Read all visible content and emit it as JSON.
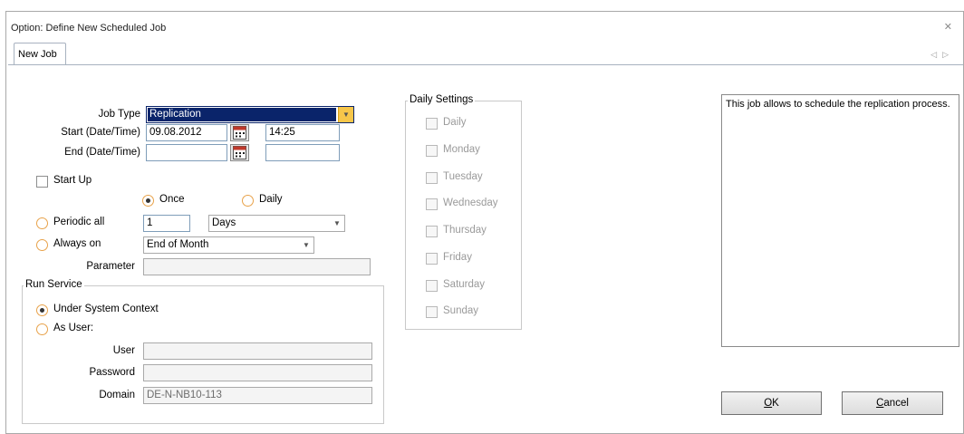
{
  "window": {
    "title": "Option: Define New Scheduled Job",
    "close_icon": "close-icon"
  },
  "tabs": [
    {
      "label": "New Job",
      "active": true
    }
  ],
  "form": {
    "job_type_label": "Job Type",
    "job_type_value": "Replication",
    "start_label": "Start (Date/Time)",
    "start_date": "09.08.2012",
    "start_time": "14:25",
    "end_label": "End (Date/Time)",
    "end_date": "",
    "end_time": "",
    "start_up_label": "Start Up",
    "once_label": "Once",
    "daily_label": "Daily",
    "periodic_label": "Periodic all",
    "periodic_value": "1",
    "periodic_unit": "Days",
    "always_on_label": "Always on",
    "always_on_value": "End of Month",
    "parameter_label": "Parameter",
    "parameter_value": ""
  },
  "run_service": {
    "legend": "Run Service",
    "system_context_label": "Under System Context",
    "as_user_label": "As User:",
    "user_label": "User",
    "user_value": "",
    "password_label": "Password",
    "password_value": "",
    "domain_label": "Domain",
    "domain_value": "DE-N-NB10-113"
  },
  "daily_settings": {
    "legend": "Daily Settings",
    "days": [
      "Daily",
      "Monday",
      "Tuesday",
      "Wednesday",
      "Thursday",
      "Friday",
      "Saturday",
      "Sunday"
    ]
  },
  "description": "This job allows to schedule the replication process.",
  "buttons": {
    "ok_mnemonic": "O",
    "ok_rest": "K",
    "cancel_mnemonic": "C",
    "cancel_rest": "ancel"
  },
  "colors": {
    "selection": "#0a246a",
    "radio_border": "#e8a24a",
    "combo_button": "#f7c64a"
  }
}
